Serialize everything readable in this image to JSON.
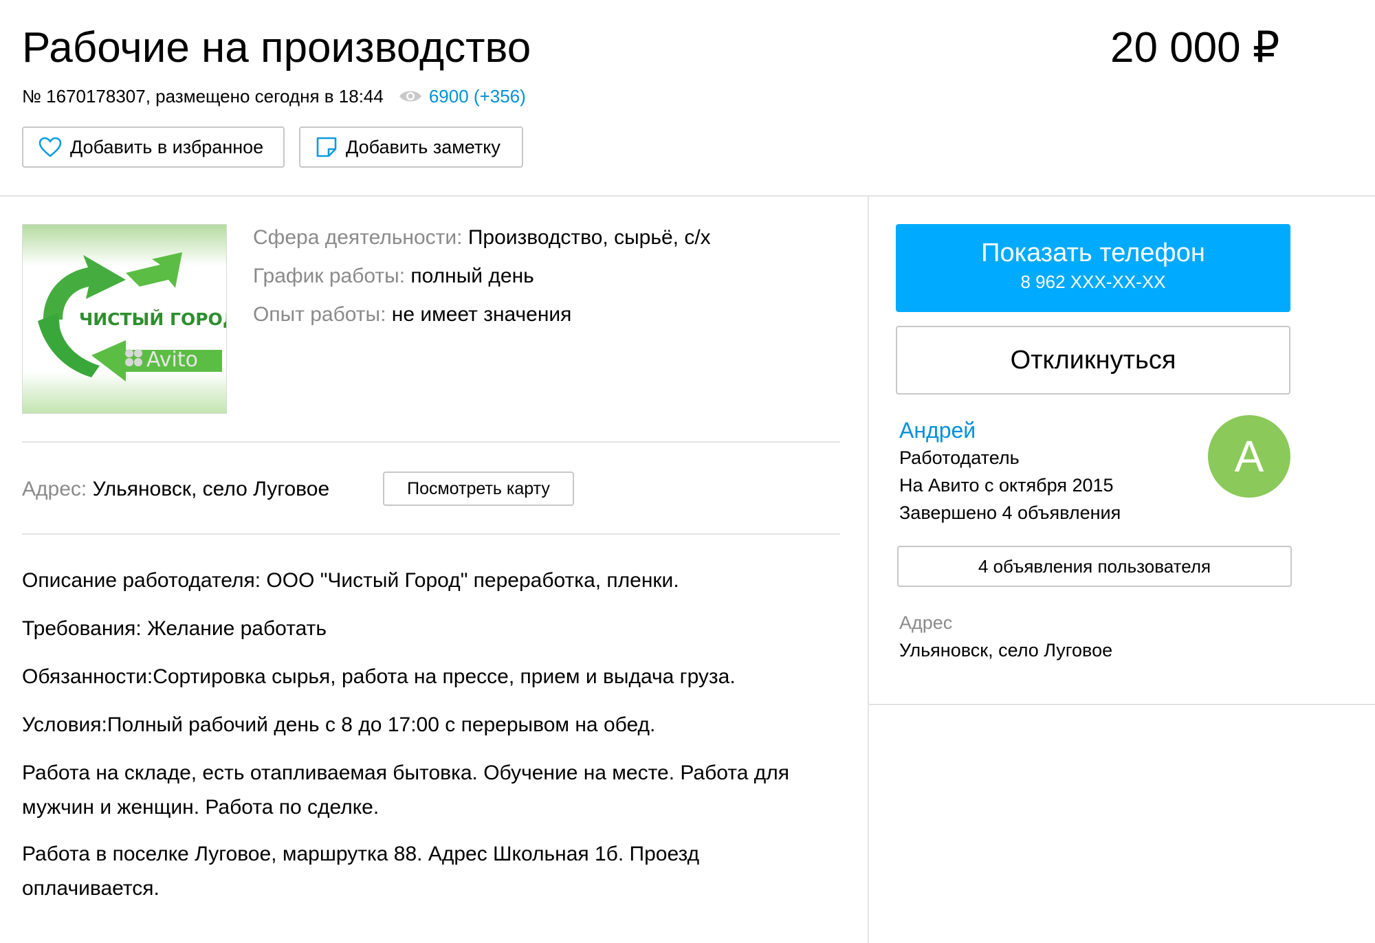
{
  "header": {
    "title": "Рабочие на производство",
    "price": "20 000 ₽",
    "listing_info": "№ 1670178307, размещено сегодня в 18:44",
    "views": "6900 (+356)"
  },
  "actions": {
    "favorite_label": "Добавить в избранное",
    "note_label": "Добавить заметку"
  },
  "logo": {
    "company_text": "ЧИСТЫЙ ГОРОД",
    "watermark": "Avito",
    "colors": {
      "green": "#3aa73a",
      "light_green": "#6cc24a"
    }
  },
  "attributes": [
    {
      "key": "Сфера деятельности:",
      "value": "Производство, сырьё, с/х"
    },
    {
      "key": "График работы:",
      "value": "полный день"
    },
    {
      "key": "Опыт работы:",
      "value": "не имеет значения"
    }
  ],
  "address": {
    "key": "Адрес:",
    "value": "Ульяновск, село Луговое",
    "map_button": "Посмотреть карту"
  },
  "description": [
    "Описание работодателя: ООО \"Чистый Город\" переработка, пленки.",
    "Требования: Желание работать",
    "Обязанности:Сортировка сырья, работа на прессе, прием и выдача груза.",
    "Условия:Полный рабочий день с 8 до 17:00 с перерывом на обед.",
    "Работа на складе, есть отапливаемая бытовка. Обучение на месте. Работа для мужчин и женщин. Работа по сделке.",
    "Работа в поселке Луговое, маршрутка 88. Адрес Школьная 1б. Проезд оплачивается."
  ],
  "sidebar": {
    "phone_button": "Показать телефон",
    "phone_masked": "8 962 XXX-XX-XX",
    "respond_button": "Откликнуться",
    "seller": {
      "name": "Андрей",
      "role": "Работодатель",
      "since": "На Авито с октября 2015",
      "completed": "Завершено 4 объявления",
      "avatar_letter": "A"
    },
    "user_ads_button": "4 объявления пользователя",
    "address_label": "Адрес",
    "address_value": "Ульяновск, село Луговое"
  },
  "colors": {
    "accent_blue": "#00aaff",
    "link_blue": "#0091d9",
    "muted_gray": "#8a8a8a",
    "avatar_green": "#8bc95a",
    "border": "#c7c7c7"
  }
}
